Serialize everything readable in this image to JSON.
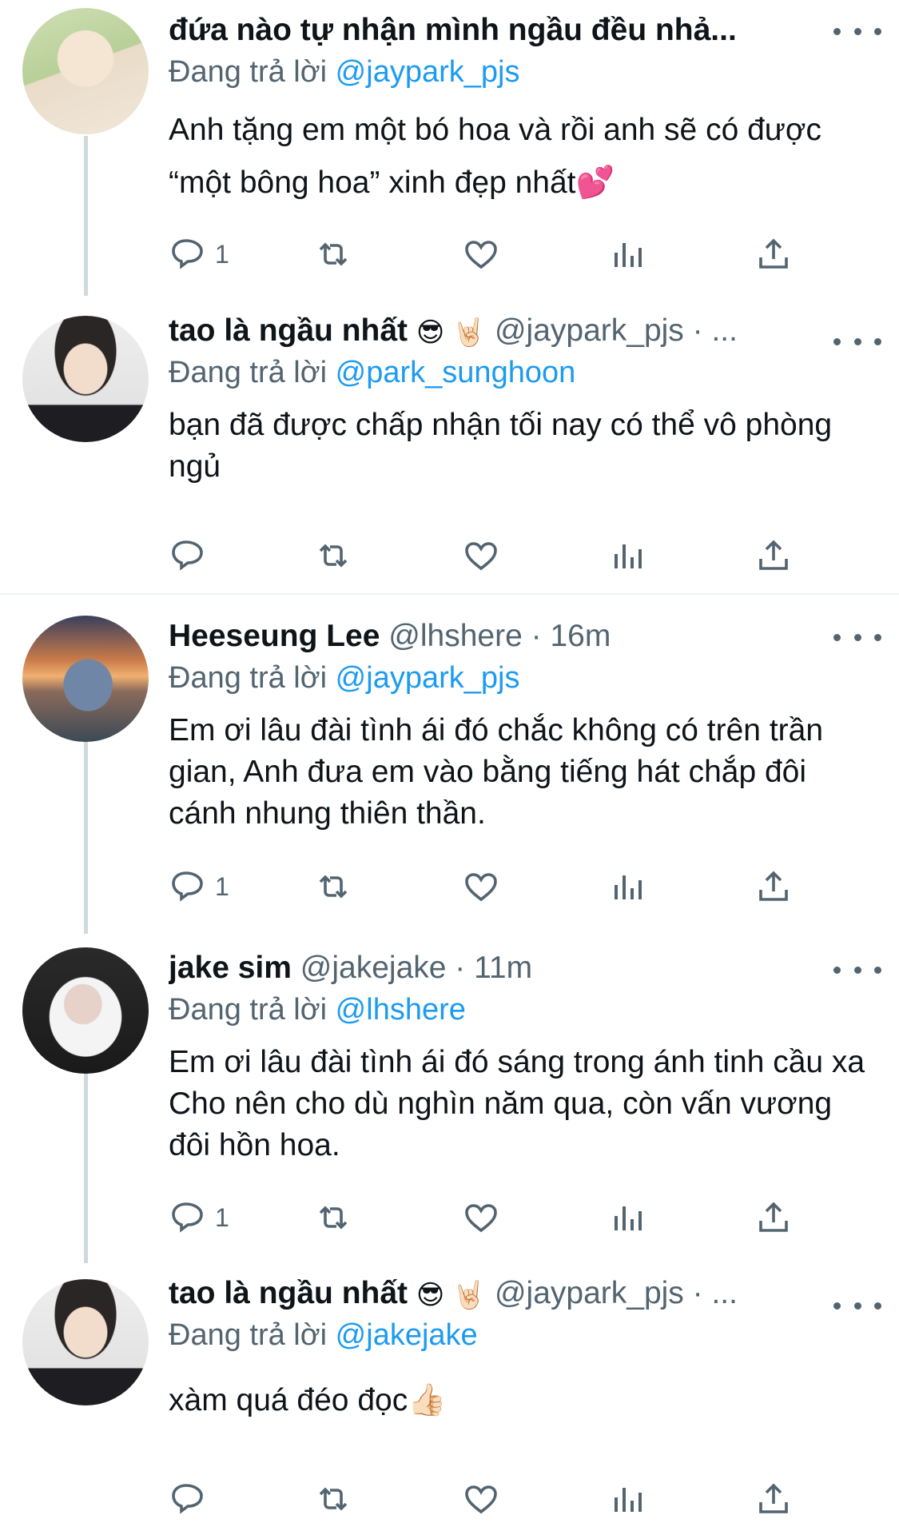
{
  "tweets": [
    {
      "name": "đứa nào tự nhận mình ngầu đều nhả...",
      "handle": "",
      "time": "",
      "replying_prefix": "Đang trả lời",
      "replying_to": "@jaypark_pjs",
      "text": "Anh tặng em một bó hoa và rồi anh sẽ có được “một bông hoa” xinh đẹp nhất💕",
      "reply_count": "1"
    },
    {
      "name": "tao là ngầu nhất",
      "emojis": "😎 🤘🏻",
      "handle": "@jaypark_pjs · ...",
      "replying_prefix": "Đang trả lời",
      "replying_to": "@park_sunghoon",
      "text": "bạn đã được chấp nhận tối nay có thể vô phòng ngủ",
      "reply_count": ""
    },
    {
      "name": "Heeseung Lee",
      "handle": "@lhshere · 16m",
      "replying_prefix": "Đang trả lời",
      "replying_to": "@jaypark_pjs",
      "text": "Em ơi lâu đài tình ái đó chắc không có trên trần gian, Anh đưa em vào bằng tiếng hát chắp đôi cánh nhung thiên thần.",
      "reply_count": "1"
    },
    {
      "name": "jake sim",
      "handle": "@jakejake · 11m",
      "replying_prefix": "Đang trả lời",
      "replying_to": "@lhshere",
      "text": "Em ơi lâu đài tình ái đó sáng trong ánh tinh cầu xa Cho nên cho dù nghìn năm qua, còn vấn vương đôi hồn hoa.",
      "reply_count": "1"
    },
    {
      "name": "tao là ngầu nhất",
      "emojis": "😎 🤘🏻",
      "handle": "@jaypark_pjs · ...",
      "replying_prefix": "Đang trả lời",
      "replying_to": "@jakejake",
      "text": "xàm quá đéo đọc👍🏻",
      "reply_count": ""
    }
  ]
}
